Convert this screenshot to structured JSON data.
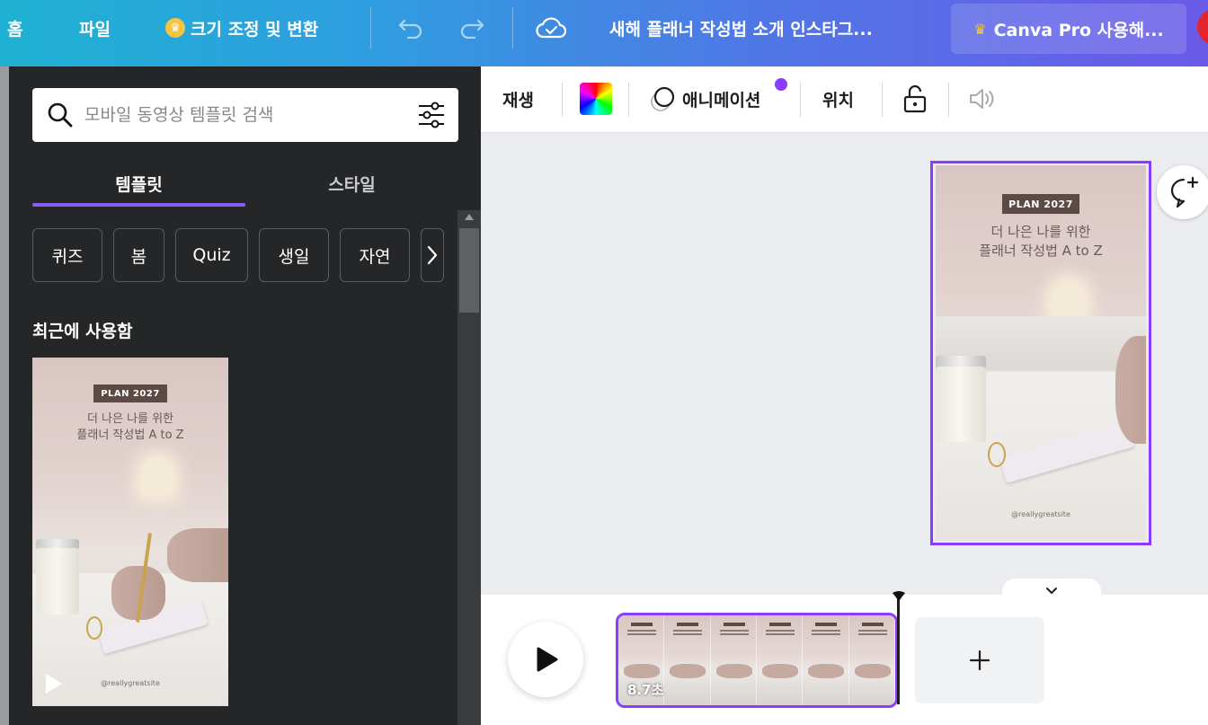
{
  "topbar": {
    "home": "홈",
    "file": "파일",
    "resize": "크기 조정 및 변환",
    "doc_title": "새해 플래너 작성법 소개 인스타그...",
    "pro_button": "Canva Pro 사용해..."
  },
  "sidebar": {
    "search_placeholder": "모바일 동영상 템플릿 검색",
    "tabs": [
      {
        "label": "템플릿",
        "active": true
      },
      {
        "label": "스타일",
        "active": false
      }
    ],
    "chips": [
      "퀴즈",
      "봄",
      "Quiz",
      "생일",
      "자연"
    ],
    "recent_title": "최근에 사용함"
  },
  "design": {
    "badge": "PLAN 2027",
    "title_line1": "더 나은 나를 위한",
    "title_line2": "플래너 작성법 A to Z",
    "site": "@reallygreatsite"
  },
  "toolbar": {
    "play": "재생",
    "animation": "애니메이션",
    "position": "위치"
  },
  "timeline": {
    "duration": "8.7초"
  },
  "colors": {
    "accent": "#8b3dff",
    "topbar_start": "#1fb1d3",
    "topbar_end": "#6a5ae8",
    "panel_bg": "#252627"
  }
}
